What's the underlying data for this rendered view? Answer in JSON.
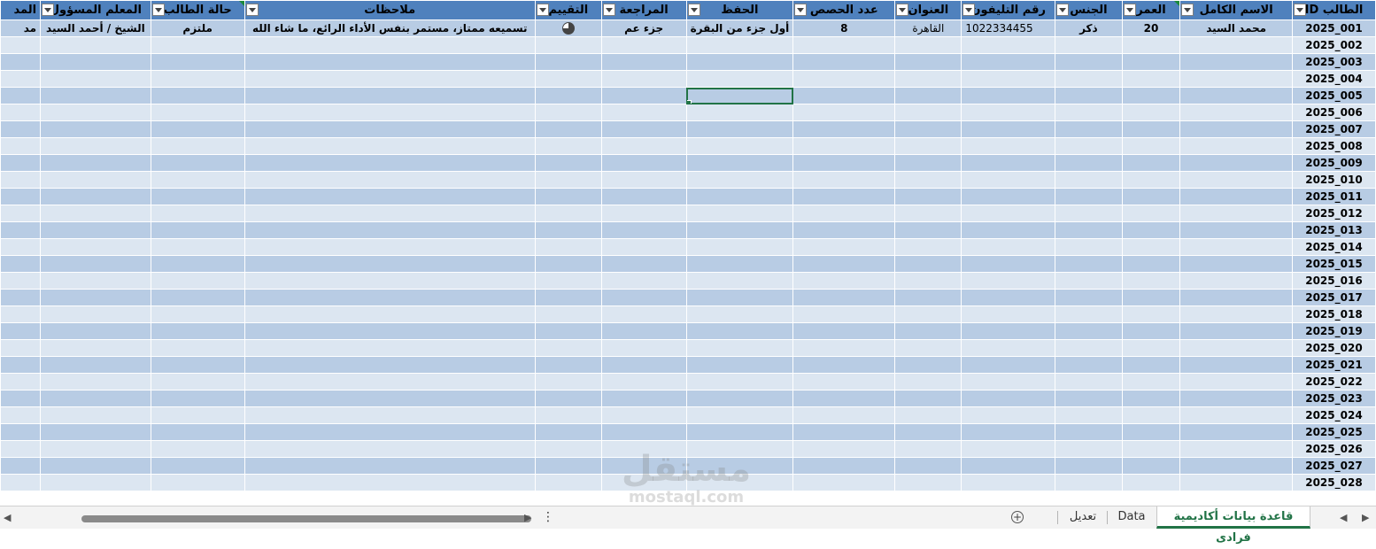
{
  "columns": [
    {
      "key": "id",
      "label": "الطالب ID",
      "filter": true,
      "tick": false
    },
    {
      "key": "name",
      "label": "الاسم الكامل",
      "filter": true,
      "tick": false
    },
    {
      "key": "age",
      "label": "العمر",
      "filter": true,
      "tick": true
    },
    {
      "key": "gender",
      "label": "الجنس",
      "filter": true,
      "tick": false
    },
    {
      "key": "phone",
      "label": "رقم التليفون",
      "filter": true,
      "tick": false
    },
    {
      "key": "address",
      "label": "العنوان",
      "filter": true,
      "tick": false
    },
    {
      "key": "sessions",
      "label": "عدد الحصص",
      "filter": true,
      "tick": false
    },
    {
      "key": "memorization",
      "label": "الحفظ",
      "filter": true,
      "tick": false
    },
    {
      "key": "review",
      "label": "المراجعة",
      "filter": true,
      "tick": false
    },
    {
      "key": "rating",
      "label": "التقييم",
      "filter": true,
      "tick": false
    },
    {
      "key": "notes",
      "label": "ملاحظات",
      "filter": true,
      "tick": false
    },
    {
      "key": "status",
      "label": "حالة الطالب",
      "filter": true,
      "tick": true
    },
    {
      "key": "teacher",
      "label": "المعلم المسؤول",
      "filter": true,
      "tick": false
    },
    {
      "key": "extra",
      "label": "المد",
      "filter": false,
      "tick": false
    }
  ],
  "first_row": {
    "id": "2025_001",
    "name": "محمد السيد",
    "age": "20",
    "gender": "ذكر",
    "phone": "1022334455",
    "address": "القاهرة",
    "sessions": "8",
    "memorization": "أول جزء من البقرة",
    "review": "جزء عم",
    "rating_icon": "three-quarter-circle-icon",
    "notes": "تسميعه ممتاز، مستمر بنفس الأداء الرائع، ما شاء الله",
    "status": "ملتزم",
    "teacher": "الشيخ / أحمد السيد",
    "extra": "مد"
  },
  "row_ids": [
    "2025_002",
    "2025_003",
    "2025_004",
    "2025_005",
    "2025_006",
    "2025_007",
    "2025_008",
    "2025_009",
    "2025_010",
    "2025_011",
    "2025_012",
    "2025_013",
    "2025_014",
    "2025_015",
    "2025_016",
    "2025_017",
    "2025_018",
    "2025_019",
    "2025_020",
    "2025_021",
    "2025_022",
    "2025_023",
    "2025_024",
    "2025_025",
    "2025_026",
    "2025_027",
    "2025_028"
  ],
  "selected_cell": {
    "row": "2025_005",
    "column": "الحفظ"
  },
  "sheet_tabs": [
    {
      "label": "قاعدة بيانات أكاديمية فرادى",
      "active": true
    },
    {
      "label": "Data",
      "active": false
    },
    {
      "label": "تعديل",
      "active": false
    }
  ],
  "add_sheet_label": "+",
  "more_label": "⋮",
  "watermark": {
    "arabic": "مستقل",
    "latin": "mostaql.com"
  },
  "colors": {
    "header": "#4f81bd",
    "band_dark": "#b8cce4",
    "band_light": "#dce6f1",
    "accent": "#217346"
  }
}
